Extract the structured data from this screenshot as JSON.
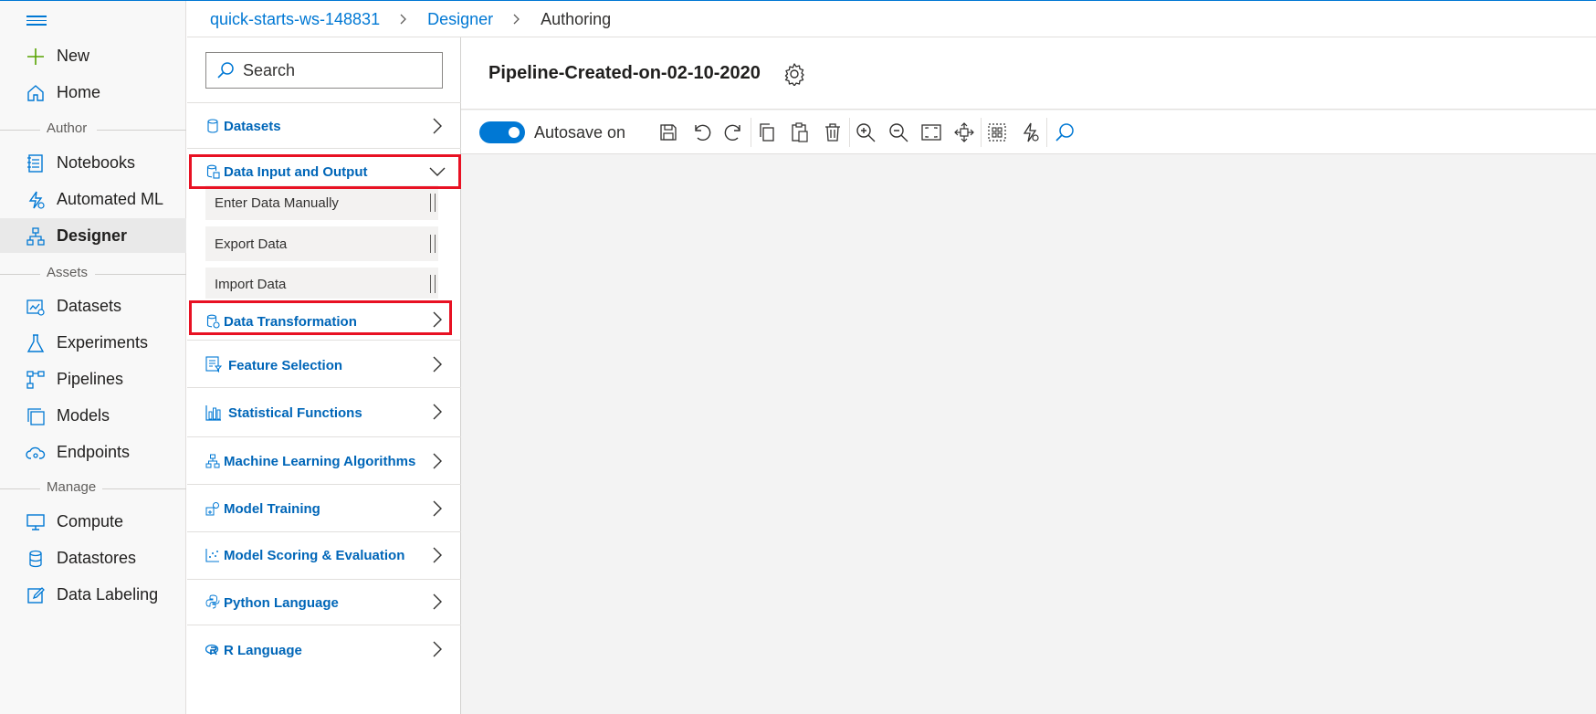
{
  "breadcrumb": {
    "workspace": "quick-starts-ws-148831",
    "designer": "Designer",
    "current": "Authoring"
  },
  "nav": {
    "new": "New",
    "home": "Home",
    "author_section": "Author",
    "notebooks": "Notebooks",
    "automated_ml": "Automated ML",
    "designer": "Designer",
    "assets_section": "Assets",
    "datasets": "Datasets",
    "experiments": "Experiments",
    "pipelines": "Pipelines",
    "models": "Models",
    "endpoints": "Endpoints",
    "manage_section": "Manage",
    "compute": "Compute",
    "datastores": "Datastores",
    "data_labeling": "Data Labeling"
  },
  "modules": {
    "search_placeholder": "Search",
    "categories": {
      "datasets": "Datasets",
      "data_io": "Data Input and Output",
      "data_transformation": "Data Transformation",
      "feature_selection": "Feature Selection",
      "statistical_functions": "Statistical Functions",
      "ml_algorithms": "Machine Learning Algorithms",
      "model_training": "Model Training",
      "model_scoring": "Model Scoring & Evaluation",
      "python_language": "Python Language",
      "r_language": "R Language"
    },
    "data_io_items": {
      "enter_data": "Enter Data Manually",
      "export_data": "Export Data",
      "import_data": "Import Data"
    }
  },
  "pipeline": {
    "name": "Pipeline-Created-on-02-10-2020",
    "autosave_label": "Autosave on",
    "autosave_on": true
  },
  "colors": {
    "accent": "#0078d4",
    "category_text": "#0066b8",
    "highlight": "#e81123",
    "canvas": "#f3f3f3"
  }
}
